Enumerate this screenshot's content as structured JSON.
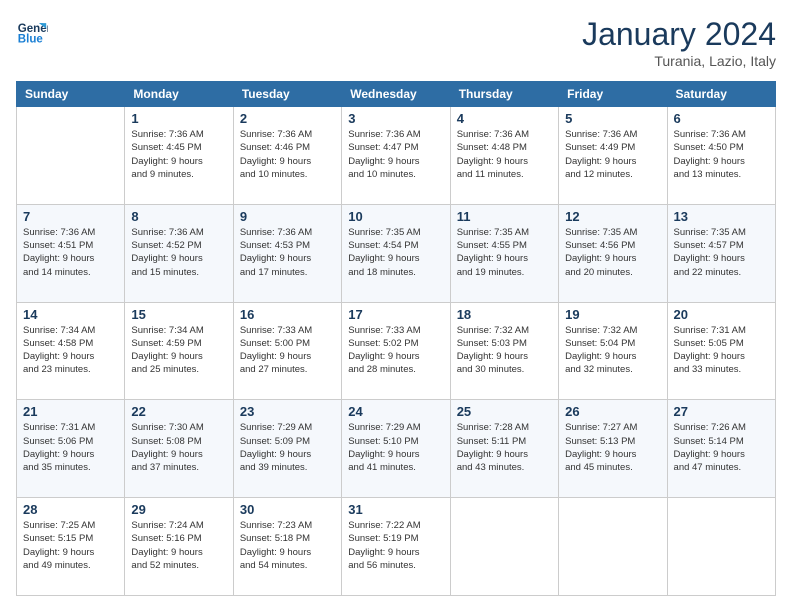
{
  "header": {
    "logo_general": "General",
    "logo_blue": "Blue",
    "month_title": "January 2024",
    "location": "Turania, Lazio, Italy"
  },
  "weekdays": [
    "Sunday",
    "Monday",
    "Tuesday",
    "Wednesday",
    "Thursday",
    "Friday",
    "Saturday"
  ],
  "weeks": [
    [
      {
        "day": "",
        "info": ""
      },
      {
        "day": "1",
        "info": "Sunrise: 7:36 AM\nSunset: 4:45 PM\nDaylight: 9 hours\nand 9 minutes."
      },
      {
        "day": "2",
        "info": "Sunrise: 7:36 AM\nSunset: 4:46 PM\nDaylight: 9 hours\nand 10 minutes."
      },
      {
        "day": "3",
        "info": "Sunrise: 7:36 AM\nSunset: 4:47 PM\nDaylight: 9 hours\nand 10 minutes."
      },
      {
        "day": "4",
        "info": "Sunrise: 7:36 AM\nSunset: 4:48 PM\nDaylight: 9 hours\nand 11 minutes."
      },
      {
        "day": "5",
        "info": "Sunrise: 7:36 AM\nSunset: 4:49 PM\nDaylight: 9 hours\nand 12 minutes."
      },
      {
        "day": "6",
        "info": "Sunrise: 7:36 AM\nSunset: 4:50 PM\nDaylight: 9 hours\nand 13 minutes."
      }
    ],
    [
      {
        "day": "7",
        "info": "Sunrise: 7:36 AM\nSunset: 4:51 PM\nDaylight: 9 hours\nand 14 minutes."
      },
      {
        "day": "8",
        "info": "Sunrise: 7:36 AM\nSunset: 4:52 PM\nDaylight: 9 hours\nand 15 minutes."
      },
      {
        "day": "9",
        "info": "Sunrise: 7:36 AM\nSunset: 4:53 PM\nDaylight: 9 hours\nand 17 minutes."
      },
      {
        "day": "10",
        "info": "Sunrise: 7:35 AM\nSunset: 4:54 PM\nDaylight: 9 hours\nand 18 minutes."
      },
      {
        "day": "11",
        "info": "Sunrise: 7:35 AM\nSunset: 4:55 PM\nDaylight: 9 hours\nand 19 minutes."
      },
      {
        "day": "12",
        "info": "Sunrise: 7:35 AM\nSunset: 4:56 PM\nDaylight: 9 hours\nand 20 minutes."
      },
      {
        "day": "13",
        "info": "Sunrise: 7:35 AM\nSunset: 4:57 PM\nDaylight: 9 hours\nand 22 minutes."
      }
    ],
    [
      {
        "day": "14",
        "info": "Sunrise: 7:34 AM\nSunset: 4:58 PM\nDaylight: 9 hours\nand 23 minutes."
      },
      {
        "day": "15",
        "info": "Sunrise: 7:34 AM\nSunset: 4:59 PM\nDaylight: 9 hours\nand 25 minutes."
      },
      {
        "day": "16",
        "info": "Sunrise: 7:33 AM\nSunset: 5:00 PM\nDaylight: 9 hours\nand 27 minutes."
      },
      {
        "day": "17",
        "info": "Sunrise: 7:33 AM\nSunset: 5:02 PM\nDaylight: 9 hours\nand 28 minutes."
      },
      {
        "day": "18",
        "info": "Sunrise: 7:32 AM\nSunset: 5:03 PM\nDaylight: 9 hours\nand 30 minutes."
      },
      {
        "day": "19",
        "info": "Sunrise: 7:32 AM\nSunset: 5:04 PM\nDaylight: 9 hours\nand 32 minutes."
      },
      {
        "day": "20",
        "info": "Sunrise: 7:31 AM\nSunset: 5:05 PM\nDaylight: 9 hours\nand 33 minutes."
      }
    ],
    [
      {
        "day": "21",
        "info": "Sunrise: 7:31 AM\nSunset: 5:06 PM\nDaylight: 9 hours\nand 35 minutes."
      },
      {
        "day": "22",
        "info": "Sunrise: 7:30 AM\nSunset: 5:08 PM\nDaylight: 9 hours\nand 37 minutes."
      },
      {
        "day": "23",
        "info": "Sunrise: 7:29 AM\nSunset: 5:09 PM\nDaylight: 9 hours\nand 39 minutes."
      },
      {
        "day": "24",
        "info": "Sunrise: 7:29 AM\nSunset: 5:10 PM\nDaylight: 9 hours\nand 41 minutes."
      },
      {
        "day": "25",
        "info": "Sunrise: 7:28 AM\nSunset: 5:11 PM\nDaylight: 9 hours\nand 43 minutes."
      },
      {
        "day": "26",
        "info": "Sunrise: 7:27 AM\nSunset: 5:13 PM\nDaylight: 9 hours\nand 45 minutes."
      },
      {
        "day": "27",
        "info": "Sunrise: 7:26 AM\nSunset: 5:14 PM\nDaylight: 9 hours\nand 47 minutes."
      }
    ],
    [
      {
        "day": "28",
        "info": "Sunrise: 7:25 AM\nSunset: 5:15 PM\nDaylight: 9 hours\nand 49 minutes."
      },
      {
        "day": "29",
        "info": "Sunrise: 7:24 AM\nSunset: 5:16 PM\nDaylight: 9 hours\nand 52 minutes."
      },
      {
        "day": "30",
        "info": "Sunrise: 7:23 AM\nSunset: 5:18 PM\nDaylight: 9 hours\nand 54 minutes."
      },
      {
        "day": "31",
        "info": "Sunrise: 7:22 AM\nSunset: 5:19 PM\nDaylight: 9 hours\nand 56 minutes."
      },
      {
        "day": "",
        "info": ""
      },
      {
        "day": "",
        "info": ""
      },
      {
        "day": "",
        "info": ""
      }
    ]
  ]
}
